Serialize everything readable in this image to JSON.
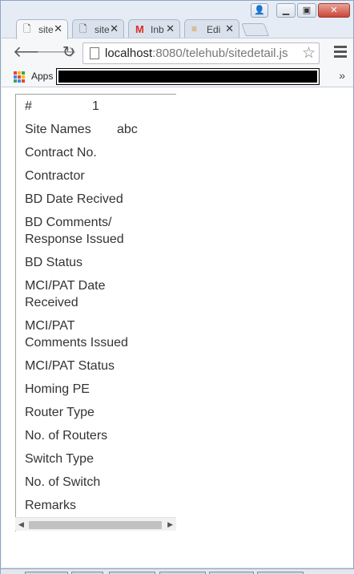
{
  "browser": {
    "tabs": [
      {
        "title": "site",
        "icon": "page-icon",
        "active": true
      },
      {
        "title": "site",
        "icon": "page-icon",
        "active": false
      },
      {
        "title": "Inb",
        "icon": "gmail-icon",
        "active": false
      },
      {
        "title": "Edi",
        "icon": "stack-icon",
        "active": false
      }
    ],
    "close_glyph": "✕",
    "url_host": "localhost",
    "url_path": ":8080/telehub/sitedetail.js",
    "bookmarks": {
      "apps_label": "Apps",
      "more": "»"
    }
  },
  "site_detail": {
    "rows": [
      {
        "label": "#",
        "value": "1"
      },
      {
        "label": "Site Names",
        "value": "abc"
      },
      {
        "label": "Contract No."
      },
      {
        "label": "Contractor"
      },
      {
        "label": "BD Date Recived"
      },
      {
        "label_line1": "BD Comments/",
        "label_line2": "Response Issued"
      },
      {
        "label": "BD Status"
      },
      {
        "label_line1": "MCI/PAT Date",
        "label_line2": "Received"
      },
      {
        "label_line1": "MCI/PAT",
        "label_line2": "Comments Issued"
      },
      {
        "label": "MCI/PAT Status"
      },
      {
        "label": "Homing PE"
      },
      {
        "label": "Router Type"
      },
      {
        "label": "No. of Routers"
      },
      {
        "label": "Switch Type"
      },
      {
        "label": "No. of Switch"
      },
      {
        "label": "Remarks"
      }
    ]
  },
  "colors": {
    "apps_grid": [
      "#e94335",
      "#fbbc05",
      "#34a853",
      "#4285f4",
      "#e94335",
      "#fbbc05",
      "#34a853",
      "#4285f4",
      "#e94335"
    ]
  }
}
